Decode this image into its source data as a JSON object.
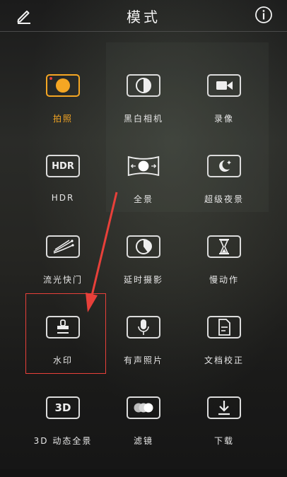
{
  "header": {
    "title": "模式",
    "edit_icon": "pencil-icon",
    "info_icon": "info-icon"
  },
  "accent_color": "#f5a623",
  "modes": [
    {
      "id": "photo",
      "label": "拍照",
      "icon": "photo-icon",
      "active": true
    },
    {
      "id": "mono",
      "label": "黑白相机",
      "icon": "monochrome-icon",
      "active": false
    },
    {
      "id": "video",
      "label": "录像",
      "icon": "video-camera-icon",
      "active": false
    },
    {
      "id": "hdr",
      "label": "HDR",
      "icon": "hdr-icon",
      "icon_text": "HDR",
      "active": false
    },
    {
      "id": "panorama",
      "label": "全景",
      "icon": "panorama-icon",
      "active": false
    },
    {
      "id": "night",
      "label": "超级夜景",
      "icon": "moon-icon",
      "active": false
    },
    {
      "id": "light",
      "label": "流光快门",
      "icon": "light-trail-icon",
      "active": false
    },
    {
      "id": "timelapse",
      "label": "延时摄影",
      "icon": "timelapse-icon",
      "active": false
    },
    {
      "id": "slowmo",
      "label": "慢动作",
      "icon": "hourglass-icon",
      "active": false
    },
    {
      "id": "watermark",
      "label": "水印",
      "icon": "stamp-icon",
      "active": false
    },
    {
      "id": "audio",
      "label": "有声照片",
      "icon": "microphone-icon",
      "active": false
    },
    {
      "id": "document",
      "label": "文档校正",
      "icon": "document-icon",
      "active": false
    },
    {
      "id": "3d",
      "label": "3D 动态全景",
      "icon": "3d-icon",
      "icon_text": "3D",
      "active": false
    },
    {
      "id": "filter",
      "label": "滤镜",
      "icon": "filter-icon",
      "active": false
    },
    {
      "id": "download",
      "label": "下载",
      "icon": "download-icon",
      "active": false
    }
  ],
  "annotation": {
    "color": "#e8403a"
  }
}
